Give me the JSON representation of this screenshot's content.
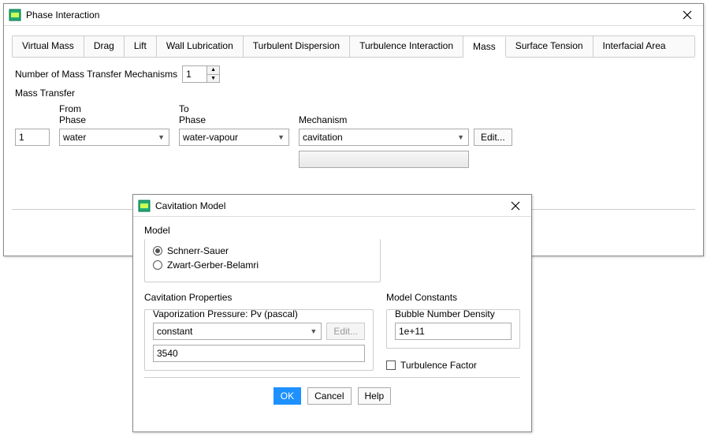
{
  "main": {
    "title": "Phase Interaction",
    "tabs": [
      {
        "label": "Virtual Mass",
        "active": false
      },
      {
        "label": "Drag",
        "active": false
      },
      {
        "label": "Lift",
        "active": false
      },
      {
        "label": "Wall Lubrication",
        "active": false
      },
      {
        "label": "Turbulent Dispersion",
        "active": false
      },
      {
        "label": "Turbulence Interaction",
        "active": false
      },
      {
        "label": "Mass",
        "active": true
      },
      {
        "label": "Surface Tension",
        "active": false
      },
      {
        "label": "Interfacial Area",
        "active": false
      }
    ],
    "num_mechanisms_label": "Number of Mass Transfer Mechanisms",
    "num_mechanisms_value": "1",
    "section_title": "Mass Transfer",
    "headers": {
      "from_line1": "From",
      "from_line2": "Phase",
      "to_line1": "To",
      "to_line2": "Phase",
      "mechanism": "Mechanism"
    },
    "row": {
      "index": "1",
      "from_phase": "water",
      "to_phase": "water-vapour",
      "mechanism": "cavitation",
      "edit_label": "Edit..."
    }
  },
  "cavitation": {
    "title": "Cavitation Model",
    "model_label": "Model",
    "option1": "Schnerr-Sauer",
    "option2": "Zwart-Gerber-Belamri",
    "selected_option": 1,
    "props_label": "Cavitation Properties",
    "pv_label": "Vaporization Pressure: Pv (pascal)",
    "pv_mode": "constant",
    "pv_edit": "Edit...",
    "pv_value": "3540",
    "constants_label": "Model Constants",
    "bubble_label": "Bubble Number Density",
    "bubble_value": "1e+11",
    "turb_factor_label": "Turbulence Factor",
    "ok": "OK",
    "cancel": "Cancel",
    "help": "Help"
  }
}
